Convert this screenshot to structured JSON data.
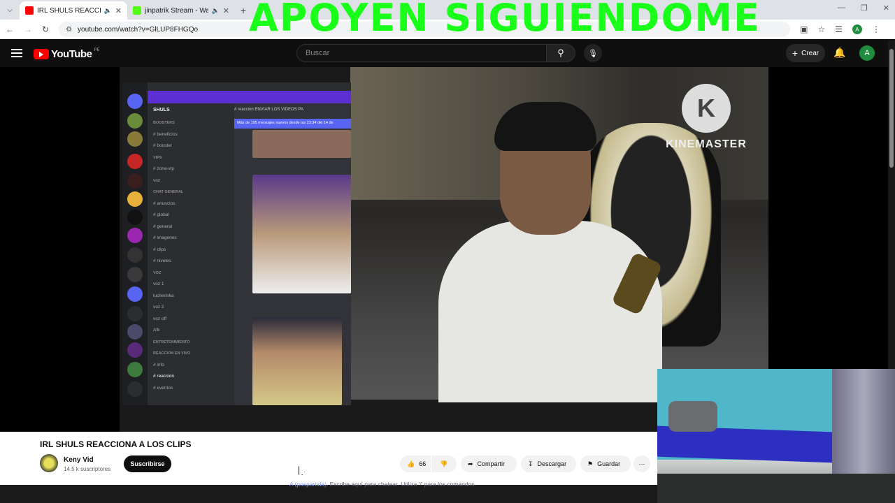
{
  "browser": {
    "tabs": [
      {
        "title": "IRL SHULS REACCIONA A LOS",
        "active": true,
        "favicon_color": "#ff0000"
      },
      {
        "title": "jinpatrik Stream - Watch Liv",
        "active": false,
        "favicon_color": "#53fc18"
      }
    ],
    "url": "youtube.com/watch?v=GlLUP8FHGQo"
  },
  "overlay": {
    "banner_text": "APOYEN SIGUIENDOME",
    "banner_color": "#1aff1a",
    "watermark_letter": "K",
    "watermark_name": "KINEMASTER"
  },
  "youtube": {
    "logo_text": "YouTube",
    "country_code": "PE",
    "search_placeholder": "Buscar",
    "create_label": "Crear",
    "avatar_letter": "A"
  },
  "discord": {
    "server_name": "SHULS",
    "channel_header": "# reaccion   ENVIAR LOS VIDEOS PA",
    "new_messages": "Más de 195 mensajes nuevos desde las 23:34 del 14 de",
    "channels": [
      {
        "label": "BOOSTERS",
        "category": true
      },
      {
        "label": "# beneficios",
        "category": false
      },
      {
        "label": "# booster",
        "category": false
      },
      {
        "label": "VIPS",
        "category": true
      },
      {
        "label": "# zona-vip",
        "category": false
      },
      {
        "label": "voz",
        "category": false
      },
      {
        "label": "CHAT GENERAL",
        "category": true
      },
      {
        "label": "# anuncios",
        "category": false
      },
      {
        "label": "# global",
        "category": false
      },
      {
        "label": "# general",
        "category": false
      },
      {
        "label": "# imagenes",
        "category": false
      },
      {
        "label": "# clips",
        "category": false
      },
      {
        "label": "# niveles",
        "category": false
      },
      {
        "label": "VOZ",
        "category": true
      },
      {
        "label": "voz 1",
        "category": false
      },
      {
        "label": "lucherinka",
        "category": false
      },
      {
        "label": "voz 2",
        "category": false
      },
      {
        "label": "voz off",
        "category": false
      },
      {
        "label": "Afk",
        "category": false
      },
      {
        "label": "ENTRETENIMIENTO",
        "category": true
      },
      {
        "label": "REACCION EN VIVO",
        "category": true
      },
      {
        "label": "# info",
        "category": false
      },
      {
        "label": "# reaccion",
        "category": false
      },
      {
        "label": "# eventos",
        "category": false
      }
    ]
  },
  "video": {
    "title": "IRL SHULS REACCIONA A LOS CLIPS",
    "channel_name": "Keny Vid",
    "subscribers": "14.5 k suscriptores",
    "subscribe_label": "Suscribirse",
    "like_count": "66",
    "share_label": "Compartir",
    "download_label": "Descargar",
    "save_label": "Guardar",
    "more_label": "···"
  },
  "chat_hint": {
    "prefix": "A (pospartida).",
    "text": "Escribe aquí para chatear. Utiliza '/' para los comandos."
  }
}
